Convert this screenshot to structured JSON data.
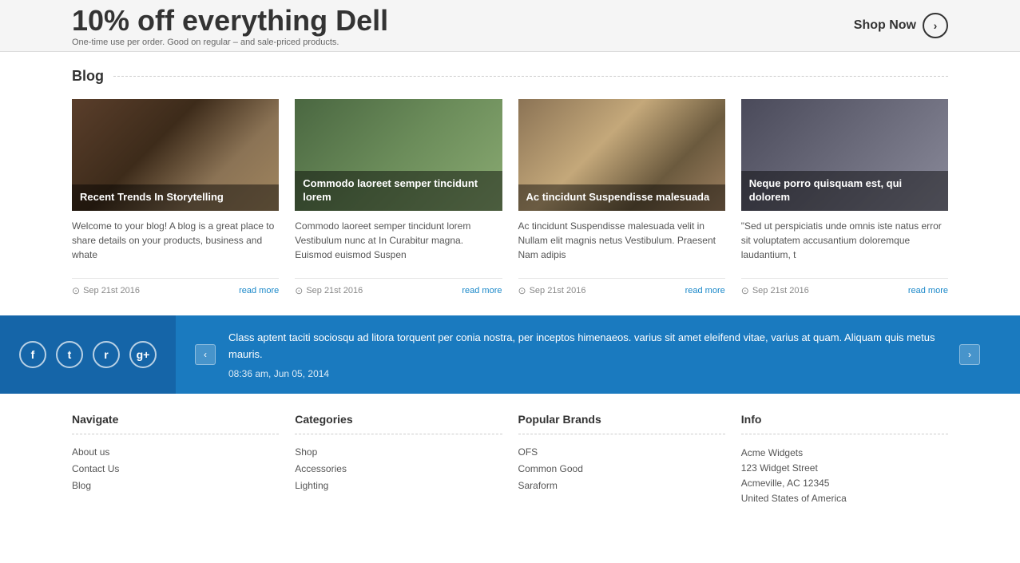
{
  "banner": {
    "title": "10% off everything Dell",
    "subtitle": "One-time use per order. Good on regular – and sale-priced products.",
    "shop_now": "Shop Now"
  },
  "blog": {
    "section_label": "Blog",
    "cards": [
      {
        "title": "Recent Trends In Storytelling",
        "excerpt": "Welcome to your blog! A blog is a great place to share details on your products, business and whate",
        "date": "Sep 21st 2016",
        "read_more": "read more"
      },
      {
        "title": "Commodo laoreet semper tincidunt lorem",
        "excerpt": "Commodo laoreet semper tincidunt lorem Vestibulum nunc at In Curabitur magna. Euismod euismod Suspen",
        "date": "Sep 21st 2016",
        "read_more": "read more"
      },
      {
        "title": "Ac tincidunt Suspendisse malesuada",
        "excerpt": "Ac tincidunt Suspendisse malesuada velit in Nullam elit magnis netus Vestibulum. Praesent Nam adipis",
        "date": "Sep 21st 2016",
        "read_more": "read more"
      },
      {
        "title": "Neque porro quisquam est, qui dolorem",
        "excerpt": "\"Sed ut perspiciatis unde omnis iste natus error sit voluptatem accusantium doloremque laudantium, t",
        "date": "Sep 21st 2016",
        "read_more": "read more"
      }
    ]
  },
  "social": {
    "icons": [
      "f",
      "t",
      "r",
      "g"
    ]
  },
  "testimonial": {
    "text": "Class aptent taciti sociosqu ad litora torquent per conia nostra, per inceptos himenaeos. varius sit amet eleifend vitae, varius at quam. Aliquam quis metus mauris.",
    "date": "08:36 am, Jun 05, 2014",
    "prev": "‹",
    "next": "›"
  },
  "footer": {
    "navigate": {
      "title": "Navigate",
      "links": [
        "About us",
        "Contact Us",
        "Blog"
      ]
    },
    "categories": {
      "title": "Categories",
      "links": [
        "Shop",
        "Accessories",
        "Lighting"
      ]
    },
    "popular_brands": {
      "title": "Popular Brands",
      "links": [
        "OFS",
        "Common Good",
        "Saraform"
      ]
    },
    "info": {
      "title": "Info",
      "address": "Acme Widgets\n123 Widget Street\nAcmeville, AC 12345\nUnited States of America"
    }
  }
}
